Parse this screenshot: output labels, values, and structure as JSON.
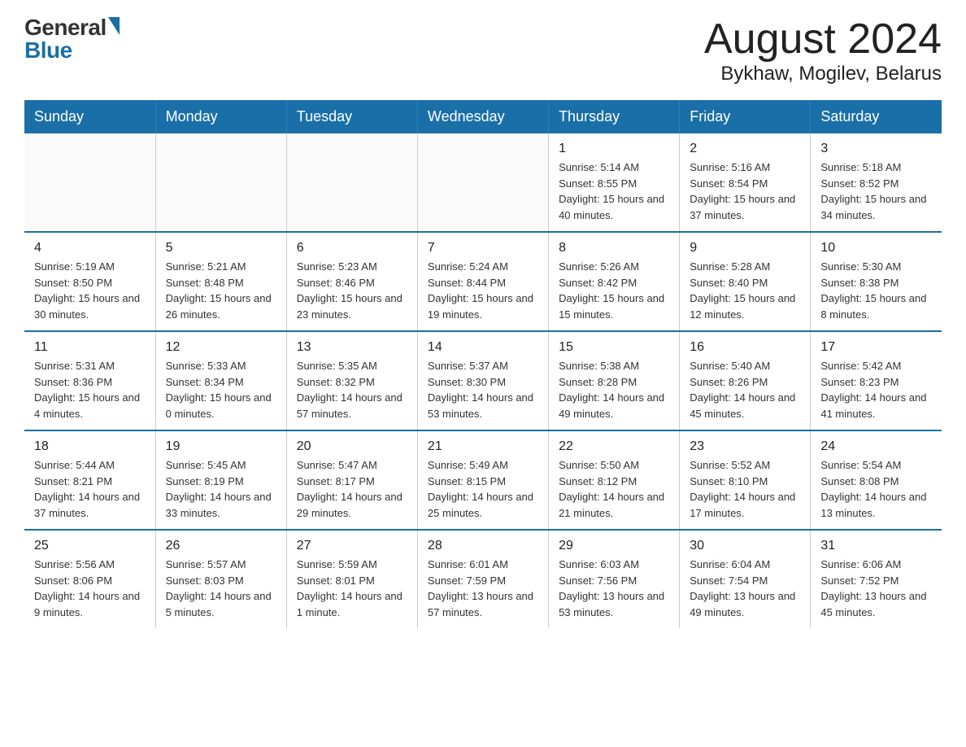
{
  "header": {
    "logo_general": "General",
    "logo_blue": "Blue",
    "month_title": "August 2024",
    "location": "Bykhaw, Mogilev, Belarus"
  },
  "days_of_week": [
    "Sunday",
    "Monday",
    "Tuesday",
    "Wednesday",
    "Thursday",
    "Friday",
    "Saturday"
  ],
  "weeks": [
    [
      {
        "day": "",
        "info": ""
      },
      {
        "day": "",
        "info": ""
      },
      {
        "day": "",
        "info": ""
      },
      {
        "day": "",
        "info": ""
      },
      {
        "day": "1",
        "info": "Sunrise: 5:14 AM\nSunset: 8:55 PM\nDaylight: 15 hours and 40 minutes."
      },
      {
        "day": "2",
        "info": "Sunrise: 5:16 AM\nSunset: 8:54 PM\nDaylight: 15 hours and 37 minutes."
      },
      {
        "day": "3",
        "info": "Sunrise: 5:18 AM\nSunset: 8:52 PM\nDaylight: 15 hours and 34 minutes."
      }
    ],
    [
      {
        "day": "4",
        "info": "Sunrise: 5:19 AM\nSunset: 8:50 PM\nDaylight: 15 hours and 30 minutes."
      },
      {
        "day": "5",
        "info": "Sunrise: 5:21 AM\nSunset: 8:48 PM\nDaylight: 15 hours and 26 minutes."
      },
      {
        "day": "6",
        "info": "Sunrise: 5:23 AM\nSunset: 8:46 PM\nDaylight: 15 hours and 23 minutes."
      },
      {
        "day": "7",
        "info": "Sunrise: 5:24 AM\nSunset: 8:44 PM\nDaylight: 15 hours and 19 minutes."
      },
      {
        "day": "8",
        "info": "Sunrise: 5:26 AM\nSunset: 8:42 PM\nDaylight: 15 hours and 15 minutes."
      },
      {
        "day": "9",
        "info": "Sunrise: 5:28 AM\nSunset: 8:40 PM\nDaylight: 15 hours and 12 minutes."
      },
      {
        "day": "10",
        "info": "Sunrise: 5:30 AM\nSunset: 8:38 PM\nDaylight: 15 hours and 8 minutes."
      }
    ],
    [
      {
        "day": "11",
        "info": "Sunrise: 5:31 AM\nSunset: 8:36 PM\nDaylight: 15 hours and 4 minutes."
      },
      {
        "day": "12",
        "info": "Sunrise: 5:33 AM\nSunset: 8:34 PM\nDaylight: 15 hours and 0 minutes."
      },
      {
        "day": "13",
        "info": "Sunrise: 5:35 AM\nSunset: 8:32 PM\nDaylight: 14 hours and 57 minutes."
      },
      {
        "day": "14",
        "info": "Sunrise: 5:37 AM\nSunset: 8:30 PM\nDaylight: 14 hours and 53 minutes."
      },
      {
        "day": "15",
        "info": "Sunrise: 5:38 AM\nSunset: 8:28 PM\nDaylight: 14 hours and 49 minutes."
      },
      {
        "day": "16",
        "info": "Sunrise: 5:40 AM\nSunset: 8:26 PM\nDaylight: 14 hours and 45 minutes."
      },
      {
        "day": "17",
        "info": "Sunrise: 5:42 AM\nSunset: 8:23 PM\nDaylight: 14 hours and 41 minutes."
      }
    ],
    [
      {
        "day": "18",
        "info": "Sunrise: 5:44 AM\nSunset: 8:21 PM\nDaylight: 14 hours and 37 minutes."
      },
      {
        "day": "19",
        "info": "Sunrise: 5:45 AM\nSunset: 8:19 PM\nDaylight: 14 hours and 33 minutes."
      },
      {
        "day": "20",
        "info": "Sunrise: 5:47 AM\nSunset: 8:17 PM\nDaylight: 14 hours and 29 minutes."
      },
      {
        "day": "21",
        "info": "Sunrise: 5:49 AM\nSunset: 8:15 PM\nDaylight: 14 hours and 25 minutes."
      },
      {
        "day": "22",
        "info": "Sunrise: 5:50 AM\nSunset: 8:12 PM\nDaylight: 14 hours and 21 minutes."
      },
      {
        "day": "23",
        "info": "Sunrise: 5:52 AM\nSunset: 8:10 PM\nDaylight: 14 hours and 17 minutes."
      },
      {
        "day": "24",
        "info": "Sunrise: 5:54 AM\nSunset: 8:08 PM\nDaylight: 14 hours and 13 minutes."
      }
    ],
    [
      {
        "day": "25",
        "info": "Sunrise: 5:56 AM\nSunset: 8:06 PM\nDaylight: 14 hours and 9 minutes."
      },
      {
        "day": "26",
        "info": "Sunrise: 5:57 AM\nSunset: 8:03 PM\nDaylight: 14 hours and 5 minutes."
      },
      {
        "day": "27",
        "info": "Sunrise: 5:59 AM\nSunset: 8:01 PM\nDaylight: 14 hours and 1 minute."
      },
      {
        "day": "28",
        "info": "Sunrise: 6:01 AM\nSunset: 7:59 PM\nDaylight: 13 hours and 57 minutes."
      },
      {
        "day": "29",
        "info": "Sunrise: 6:03 AM\nSunset: 7:56 PM\nDaylight: 13 hours and 53 minutes."
      },
      {
        "day": "30",
        "info": "Sunrise: 6:04 AM\nSunset: 7:54 PM\nDaylight: 13 hours and 49 minutes."
      },
      {
        "day": "31",
        "info": "Sunrise: 6:06 AM\nSunset: 7:52 PM\nDaylight: 13 hours and 45 minutes."
      }
    ]
  ]
}
